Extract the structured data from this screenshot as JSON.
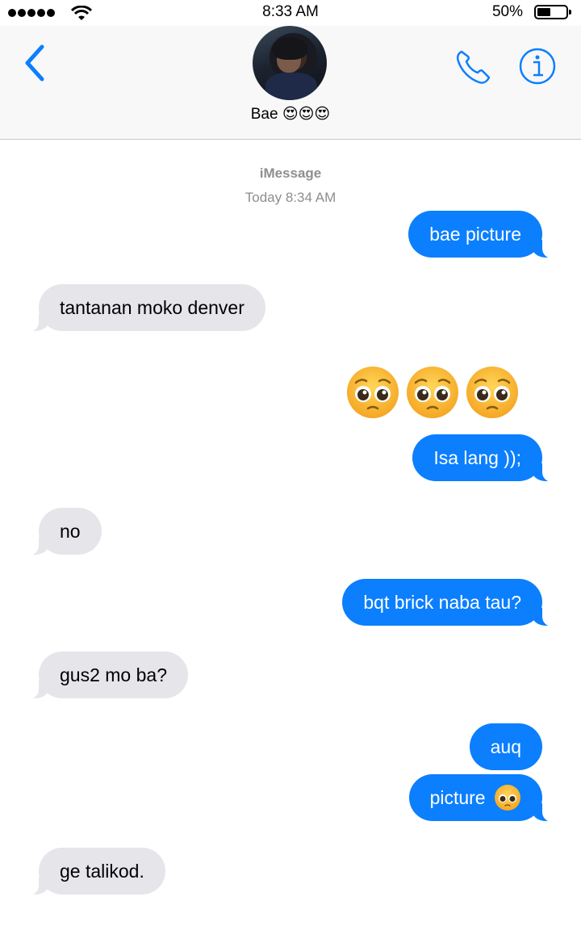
{
  "status_bar": {
    "time": "8:33 AM",
    "battery_percent": "50%",
    "battery_level": 0.5,
    "signal_bars": 5
  },
  "header": {
    "contact_name": "Bae 😍😍😍",
    "back_icon": "chevron-left-icon",
    "call_icon": "phone-icon",
    "info_icon": "info-icon",
    "accent_color": "#0b7ffe"
  },
  "thread": {
    "service": "iMessage",
    "timestamp": "Today 8:34 AM",
    "messages": [
      {
        "from": "me",
        "text": "bae picture"
      },
      {
        "from": "them",
        "text": "tantanan moko denver"
      },
      {
        "from": "me",
        "text": "🥺🥺🥺"
      },
      {
        "from": "me",
        "text": "Isa lang ));"
      },
      {
        "from": "them",
        "text": "no"
      },
      {
        "from": "me",
        "text": "bqt brick naba tau?"
      },
      {
        "from": "them",
        "text": "gus2 mo ba?"
      },
      {
        "from": "me",
        "text": "auq"
      },
      {
        "from": "me",
        "text": "picture",
        "emoji": "🥺"
      },
      {
        "from": "them",
        "text": "ge talikod."
      }
    ]
  },
  "colors": {
    "sent_bubble": "#0b7ffe",
    "received_bubble": "#e5e5ea",
    "meta_text": "#8e8e93"
  }
}
